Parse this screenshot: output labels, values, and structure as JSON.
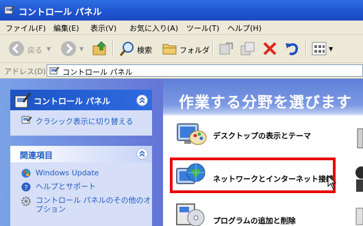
{
  "window": {
    "title": "コントロール パネル"
  },
  "menu": [
    "ファイル(F)",
    "編集(E)",
    "表示(V)",
    "お気に入り(A)",
    "ツール(T)",
    "ヘルプ(H)"
  ],
  "toolbar": {
    "back": "戻る",
    "search": "検索",
    "folders": "フォルダ"
  },
  "address": {
    "label": "アドレス(D)",
    "value": "コントロール パネル"
  },
  "left_pane": {
    "control_panel_box": {
      "title": "コントロール パネル",
      "switch_link": "クラシック表示に切り替える"
    },
    "related": {
      "title": "関連項目",
      "items": [
        "Windows Update",
        "ヘルプとサポート",
        "コントロール パネルのその他のオ",
        "プション"
      ]
    }
  },
  "main": {
    "heading": "作業する分野を選びます",
    "categories": [
      "デスクトップの表示とテーマ",
      "ネットワークとインターネット接続",
      "プログラムの追加と削除"
    ]
  },
  "colors": {
    "highlight": "#e8000b",
    "link": "#215dc6"
  }
}
